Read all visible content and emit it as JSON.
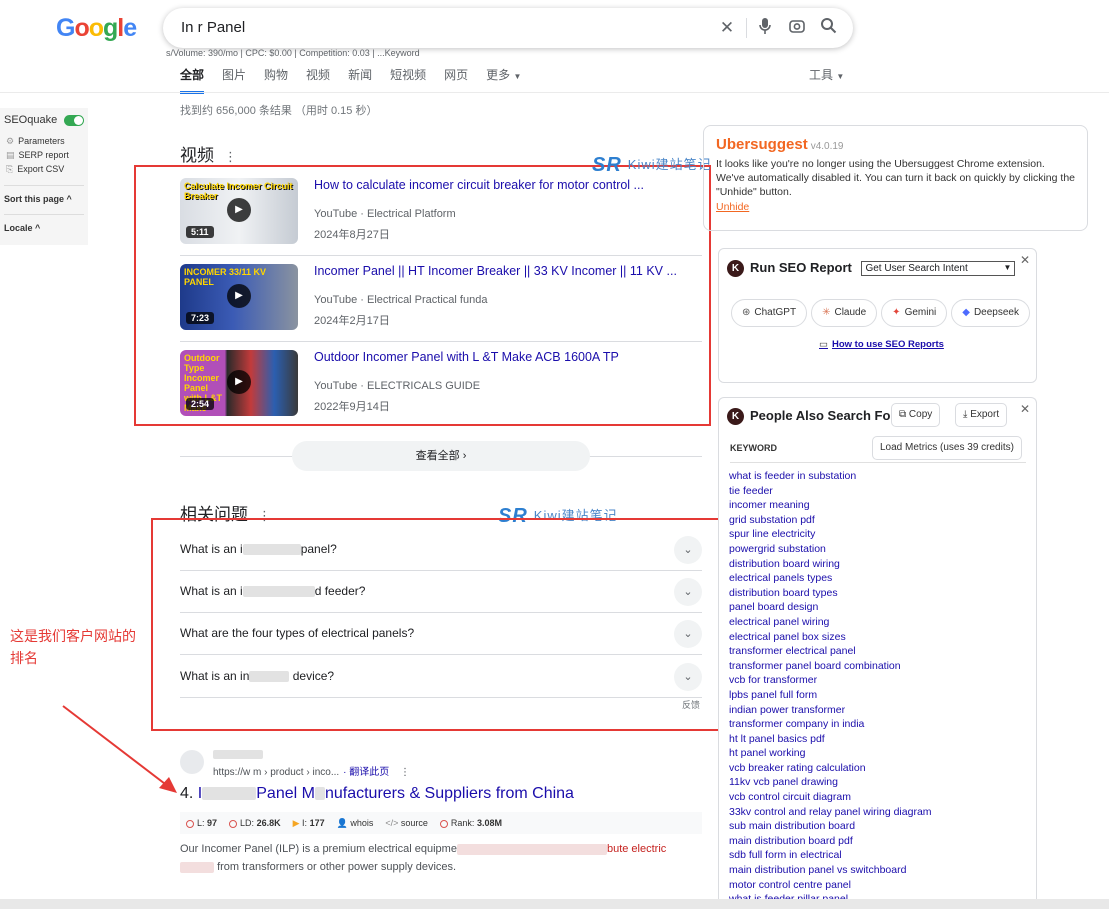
{
  "logo": "Google",
  "search": {
    "query": "In      r Panel"
  },
  "seoquake_line": "s/Volume: 390/mo | CPC: $0.00 | Competition: 0.03 | ...Keyword",
  "tabs": [
    "全部",
    "图片",
    "购物",
    "视频",
    "新闻",
    "短视频",
    "网页",
    "更多"
  ],
  "tools_label": "工具",
  "result_stats": "找到约 656,000 条结果  （用时 0.15 秒）",
  "seoquake": {
    "title": "SEOquake",
    "items": [
      "Parameters",
      "SERP report",
      "Export CSV"
    ],
    "sort_label": "Sort this page",
    "locale_label": "Locale"
  },
  "videos": {
    "heading": "视频",
    "items": [
      {
        "title": "How to calculate incomer circuit breaker for motor control ...",
        "source": "YouTube · Electrical Platform",
        "date": "2024年8月27日",
        "duration": "5:11",
        "thumb_text": "Calculate Incomer Circuit Breaker"
      },
      {
        "title": "Incomer Panel || HT Incomer Breaker || 33 KV Incomer || 11 KV ...",
        "source": "YouTube · Electrical Practical funda",
        "date": "2024年2月17日",
        "duration": "7:23",
        "thumb_text": "INCOMER 33/11 KV PANEL"
      },
      {
        "title": "Outdoor Incomer Panel with L &T Make ACB 1600A TP",
        "source": "YouTube · ELECTRICALS GUIDE",
        "date": "2022年9月14日",
        "duration": "2:54",
        "thumb_text": "Outdoor Type Incomer Panel with L&T Make"
      }
    ],
    "see_all": "查看全部"
  },
  "watermark": "Kiwi建站笔记",
  "paa": {
    "heading": "相关问题",
    "questions": [
      {
        "pre": "What is an i",
        "post": "panel?"
      },
      {
        "pre": "What is an i",
        "post": "d feeder?"
      },
      {
        "pre": "What are the four types of electrical panels?",
        "post": ""
      },
      {
        "pre": "What is an in",
        "post": "device?"
      }
    ],
    "feedback": "反馈"
  },
  "annotation": "这是我们客户网站的排名",
  "result": {
    "url": "https://w                    m › product › inco...",
    "translate": "· 翻译此页",
    "number": "4.",
    "title_pre": "I",
    "title_mid": "Panel M",
    "title_post": "nufacturers & Suppliers from China",
    "metrics": [
      {
        "label": "L:",
        "value": "97"
      },
      {
        "label": "LD:",
        "value": "26.8K"
      },
      {
        "label": "I:",
        "value": "177"
      },
      {
        "label": "",
        "value": "whois"
      },
      {
        "label": "",
        "value": "source"
      },
      {
        "label": "Rank:",
        "value": "3.08M"
      }
    ],
    "snippet_line1_pre": "Our Incomer Panel (ILP) is a premium electrical equipme",
    "snippet_line1_red": "bute electric",
    "snippet_line2": "from transformers or other power supply devices."
  },
  "ubersuggest": {
    "title": "Ubersuggest",
    "version": "v4.0.19",
    "text": "It looks like you're no longer using the Ubersuggest Chrome extension. We've automatically disabled it. You can turn it back on quickly by clicking the \"Unhide\" button.",
    "unhide": "Unhide"
  },
  "seo_report": {
    "title": "Run SEO Report",
    "select_value": "Get User Search Intent",
    "buttons": [
      "ChatGPT",
      "Claude",
      "Gemini",
      "Deepseek"
    ],
    "howto": "How to use SEO Reports"
  },
  "people_also_search": {
    "title": "People Also Search For",
    "copy": "Copy",
    "export": "Export",
    "keyword_label": "KEYWORD",
    "load_metrics": "Load Metrics (uses 39 credits)",
    "keywords": [
      "what is feeder in substation",
      "tie feeder",
      "incomer meaning",
      "grid substation pdf",
      "spur line electricity",
      "powergrid substation",
      "distribution board wiring",
      "electrical panels types",
      "distribution board types",
      "panel board design",
      "electrical panel wiring",
      "electrical panel box sizes",
      "transformer electrical panel",
      "transformer panel board combination",
      "vcb for transformer",
      "lpbs panel full form",
      "indian power transformer",
      "transformer company in india",
      "ht lt panel basics pdf",
      "ht panel working",
      "vcb breaker rating calculation",
      "11kv vcb panel drawing",
      "vcb control circuit diagram",
      "33kv control and relay panel wiring diagram",
      "sub main distribution board",
      "main distribution board pdf",
      "sdb full form in electrical",
      "main distribution panel vs switchboard",
      "motor control centre panel",
      "what is feeder pillar panel"
    ]
  }
}
